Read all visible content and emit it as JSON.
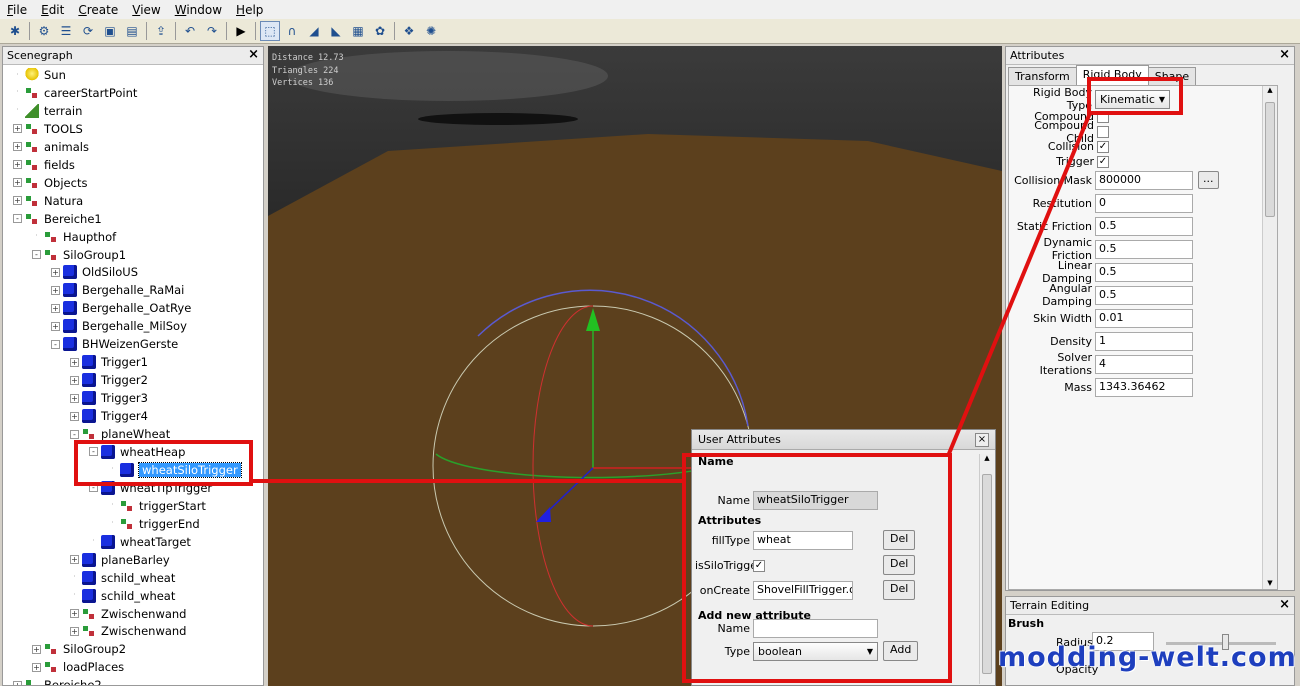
{
  "menu": [
    "File",
    "Edit",
    "Create",
    "View",
    "Window",
    "Help"
  ],
  "toolbar_icons": [
    "new-icon",
    "open-icon",
    "list-icon",
    "refresh-icon",
    "save-icon",
    "save-all-icon",
    "import-icon",
    "undo-icon",
    "redo-icon",
    "play-icon",
    "select-icon",
    "magnet-icon",
    "terrain-sculpt-icon",
    "terrain-paint-icon",
    "terrain-texture-icon",
    "foliage-icon",
    "filter-icon",
    "settings-icon"
  ],
  "scenegraph": {
    "title": "Scenegraph",
    "items": [
      {
        "label": "Sun",
        "depth": 0,
        "icon": "bulb",
        "exp": ""
      },
      {
        "label": "careerStartPoint",
        "depth": 0,
        "icon": "tg",
        "exp": ""
      },
      {
        "label": "terrain",
        "depth": 0,
        "icon": "ter",
        "exp": ""
      },
      {
        "label": "TOOLS",
        "depth": 0,
        "icon": "tg",
        "exp": "+"
      },
      {
        "label": "animals",
        "depth": 0,
        "icon": "tg",
        "exp": "+"
      },
      {
        "label": "fields",
        "depth": 0,
        "icon": "tg",
        "exp": "+"
      },
      {
        "label": "Objects",
        "depth": 0,
        "icon": "tg",
        "exp": "+"
      },
      {
        "label": "Natura",
        "depth": 0,
        "icon": "tg",
        "exp": "+"
      },
      {
        "label": "Bereiche1",
        "depth": 0,
        "icon": "tg",
        "exp": "-"
      },
      {
        "label": "Haupthof",
        "depth": 1,
        "icon": "tg",
        "exp": ""
      },
      {
        "label": "SiloGroup1",
        "depth": 1,
        "icon": "tg",
        "exp": "-"
      },
      {
        "label": "OldSiloUS",
        "depth": 2,
        "icon": "cube",
        "exp": "+"
      },
      {
        "label": "Bergehalle_RaMai",
        "depth": 2,
        "icon": "cube",
        "exp": "+"
      },
      {
        "label": "Bergehalle_OatRye",
        "depth": 2,
        "icon": "cube",
        "exp": "+"
      },
      {
        "label": "Bergehalle_MilSoy",
        "depth": 2,
        "icon": "cube",
        "exp": "+"
      },
      {
        "label": "BHWeizenGerste",
        "depth": 2,
        "icon": "cube",
        "exp": "-"
      },
      {
        "label": "Trigger1",
        "depth": 3,
        "icon": "cube",
        "exp": "+"
      },
      {
        "label": "Trigger2",
        "depth": 3,
        "icon": "cube",
        "exp": "+"
      },
      {
        "label": "Trigger3",
        "depth": 3,
        "icon": "cube",
        "exp": "+"
      },
      {
        "label": "Trigger4",
        "depth": 3,
        "icon": "cube",
        "exp": "+"
      },
      {
        "label": "planeWheat",
        "depth": 3,
        "icon": "tg",
        "exp": "-"
      },
      {
        "label": "wheatHeap",
        "depth": 4,
        "icon": "cube",
        "exp": "-"
      },
      {
        "label": "wheatSiloTrigger",
        "depth": 5,
        "icon": "cube",
        "exp": "",
        "selected": true
      },
      {
        "label": "wheatTipTrigger",
        "depth": 4,
        "icon": "cube",
        "exp": "-"
      },
      {
        "label": "triggerStart",
        "depth": 5,
        "icon": "tg",
        "exp": ""
      },
      {
        "label": "triggerEnd",
        "depth": 5,
        "icon": "tg",
        "exp": ""
      },
      {
        "label": "wheatTarget",
        "depth": 4,
        "icon": "cube",
        "exp": ""
      },
      {
        "label": "planeBarley",
        "depth": 3,
        "icon": "cube",
        "exp": "+"
      },
      {
        "label": "schild_wheat",
        "depth": 3,
        "icon": "cube",
        "exp": ""
      },
      {
        "label": "schild_wheat",
        "depth": 3,
        "icon": "cube",
        "exp": ""
      },
      {
        "label": "Zwischenwand",
        "depth": 3,
        "icon": "tg",
        "exp": "+"
      },
      {
        "label": "Zwischenwand",
        "depth": 3,
        "icon": "tg",
        "exp": "+"
      },
      {
        "label": "SiloGroup2",
        "depth": 1,
        "icon": "tg",
        "exp": "+"
      },
      {
        "label": "loadPlaces",
        "depth": 1,
        "icon": "tg",
        "exp": "+"
      },
      {
        "label": "Bereiche2",
        "depth": 0,
        "icon": "tg",
        "exp": "+"
      }
    ]
  },
  "viewport": {
    "distance": "Distance 12.73",
    "triangles": "Triangles 224",
    "vertices": "Vertices 136"
  },
  "attributes": {
    "title": "Attributes",
    "tabs": [
      "Transform",
      "Rigid Body",
      "Shape"
    ],
    "rigid_body_type_label": "Rigid Body Type",
    "rigid_body_type": "Kinematic",
    "checks": [
      {
        "label": "Compound",
        "checked": false
      },
      {
        "label": "Compound Child",
        "checked": false
      },
      {
        "label": "Collision",
        "checked": true
      },
      {
        "label": "Trigger",
        "checked": true
      }
    ],
    "fields": [
      {
        "label": "Collision Mask",
        "value": "800000",
        "ellipsis": true
      },
      {
        "label": "Restitution",
        "value": "0"
      },
      {
        "label": "Static Friction",
        "value": "0.5"
      },
      {
        "label": "Dynamic Friction",
        "value": "0.5"
      },
      {
        "label": "Linear Damping",
        "value": "0.5"
      },
      {
        "label": "Angular Damping",
        "value": "0.5"
      },
      {
        "label": "Skin Width",
        "value": "0.01"
      },
      {
        "label": "Density",
        "value": "1"
      },
      {
        "label": "Solver Iterations",
        "value": "4"
      },
      {
        "label": "Mass",
        "value": "1343.36462"
      }
    ]
  },
  "terrain_editing": {
    "title": "Terrain Editing",
    "brush": "Brush",
    "radius_label": "Radius",
    "radius": "0.2",
    "opacity_label": "Opacity"
  },
  "user_attributes": {
    "title": "User Attributes",
    "name_section": "Name",
    "name_label": "Name",
    "name_value": "wheatSiloTrigger",
    "attributes_section": "Attributes",
    "attrs": [
      {
        "label": "fillType",
        "value": "wheat",
        "type": "text"
      },
      {
        "label": "isSiloTrigger",
        "value": "",
        "type": "check"
      },
      {
        "label": "onCreate",
        "value": "ShovelFillTrigger.on",
        "type": "text"
      }
    ],
    "del_label": "Del",
    "add_section": "Add new attribute",
    "new_name_label": "Name",
    "new_type_label": "Type",
    "new_type_value": "boolean",
    "add_label": "Add"
  },
  "watermark": "modding-welt.com",
  "colors": {
    "highlight": "#e01010",
    "selection": "#3399ff"
  }
}
